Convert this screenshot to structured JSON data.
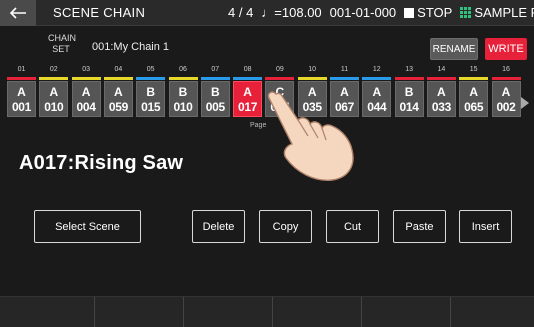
{
  "header": {
    "title": "SCENE CHAIN",
    "time_signature": "4 / 4",
    "tempo": "♩=108.00",
    "position": "001-01-000",
    "transport_label": "STOP",
    "pad_mode_label": "SAMPLE PAD"
  },
  "chain": {
    "set_label": "CHAIN\nSET",
    "name": "001:My Chain 1",
    "rename_label": "RENAME",
    "write_label": "WRITE"
  },
  "steps": [
    {
      "num": "01",
      "letter": "A",
      "code": "001",
      "bar_color": "#e8213a"
    },
    {
      "num": "02",
      "letter": "A",
      "code": "010",
      "bar_color": "#e6d82a"
    },
    {
      "num": "03",
      "letter": "A",
      "code": "004",
      "bar_color": "#e6d82a"
    },
    {
      "num": "04",
      "letter": "A",
      "code": "059",
      "bar_color": "#e6d82a"
    },
    {
      "num": "05",
      "letter": "B",
      "code": "015",
      "bar_color": "#2a9be8"
    },
    {
      "num": "06",
      "letter": "B",
      "code": "010",
      "bar_color": "#e6d82a"
    },
    {
      "num": "07",
      "letter": "B",
      "code": "005",
      "bar_color": "#2a9be8"
    },
    {
      "num": "08",
      "letter": "A",
      "code": "017",
      "bar_color": "#2a9be8"
    },
    {
      "num": "09",
      "letter": "C",
      "code": "024",
      "bar_color": "#e8213a"
    },
    {
      "num": "10",
      "letter": "A",
      "code": "035",
      "bar_color": "#e6d82a"
    },
    {
      "num": "11",
      "letter": "A",
      "code": "067",
      "bar_color": "#2a9be8"
    },
    {
      "num": "12",
      "letter": "A",
      "code": "044",
      "bar_color": "#2a9be8"
    },
    {
      "num": "13",
      "letter": "B",
      "code": "014",
      "bar_color": "#e8213a"
    },
    {
      "num": "14",
      "letter": "A",
      "code": "033",
      "bar_color": "#e8213a"
    },
    {
      "num": "15",
      "letter": "A",
      "code": "065",
      "bar_color": "#e6d82a"
    },
    {
      "num": "16",
      "letter": "A",
      "code": "002",
      "bar_color": "#e8213a"
    }
  ],
  "selected_step": 7,
  "page_label": "Page",
  "scene": {
    "name": "A017:Rising Saw"
  },
  "actions": {
    "select_scene": "Select Scene",
    "delete": "Delete",
    "copy": "Copy",
    "cut": "Cut",
    "paste": "Paste",
    "insert": "Insert"
  },
  "colors": {
    "accent_red": "#e8213a",
    "yellow": "#e6d82a",
    "blue": "#2a9be8",
    "pad_icon_green": "#2ec27e"
  },
  "icons": {
    "back": "back-arrow-icon",
    "next": "chevron-right-icon",
    "transport": "stop-square-icon",
    "pad": "pad-grid-icon"
  }
}
